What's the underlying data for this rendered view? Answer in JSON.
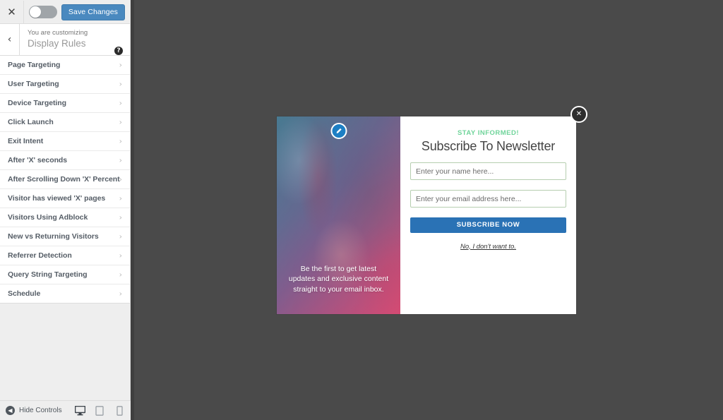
{
  "customizer": {
    "topbar": {
      "close_icon": "close-x-icon",
      "toggle_state": "off",
      "help_icon": "help-circle-icon",
      "save_label": "Save Changes",
      "save_color": "#4a89bf"
    },
    "header": {
      "back_icon": "chevron-left-icon",
      "eyebrow": "You are customizing",
      "title": "Display Rules",
      "help_icon": "help-circle-icon"
    },
    "items": [
      {
        "label": "Page Targeting",
        "chevron": "›"
      },
      {
        "label": "User Targeting",
        "chevron": "›"
      },
      {
        "label": "Device Targeting",
        "chevron": "›"
      },
      {
        "label": "Click Launch",
        "chevron": "›"
      },
      {
        "label": "Exit Intent",
        "chevron": "›"
      },
      {
        "label": "After 'X' seconds",
        "chevron": "›"
      },
      {
        "label": "After Scrolling Down 'X' Percent",
        "chevron": "›"
      },
      {
        "label": "Visitor has viewed 'X' pages",
        "chevron": "›"
      },
      {
        "label": "Visitors Using Adblock",
        "chevron": "›"
      },
      {
        "label": "New vs Returning Visitors",
        "chevron": "›"
      },
      {
        "label": "Referrer Detection",
        "chevron": "›"
      },
      {
        "label": "Query String Targeting",
        "chevron": "›"
      },
      {
        "label": "Schedule",
        "chevron": "›"
      }
    ],
    "bottom": {
      "hide_controls_label": "Hide Controls",
      "hide_icon": "collapse-left-icon",
      "devices": [
        {
          "name": "desktop-preview",
          "active": true
        },
        {
          "name": "tablet-preview",
          "active": false
        },
        {
          "name": "mobile-preview",
          "active": false
        }
      ]
    }
  },
  "preview": {
    "background_color": "#4a4a4a",
    "popup": {
      "close_icon": "close-circle-icon",
      "left_panel": {
        "edit_icon": "pencil-edit-icon",
        "image_alt": "football-player-helmet-photo",
        "caption": "Be the first to get latest updates and exclusive content straight to your email inbox.",
        "gradient_from": "#3c82a0",
        "gradient_to": "#e1466e"
      },
      "form": {
        "eyebrow": "STAY INFORMED!",
        "eyebrow_color": "#6fd49a",
        "title": "Subscribe To Newsletter",
        "name_field": {
          "value": "",
          "placeholder": "Enter your name here..."
        },
        "email_field": {
          "value": "",
          "placeholder": "Enter your email address here..."
        },
        "submit_label": "SUBSCRIBE NOW",
        "submit_color": "#2a72b5",
        "decline_label": "No, I don't want to.",
        "field_border_color": "#b6ceb0"
      }
    }
  }
}
